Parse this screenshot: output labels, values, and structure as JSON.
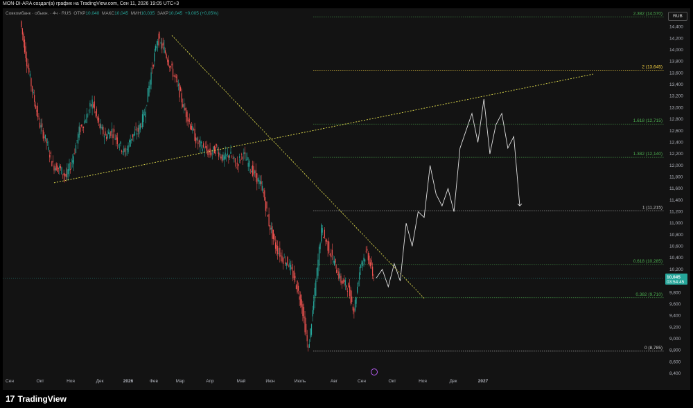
{
  "header": {
    "title": "MON-DI-ARA создал(а) график на TradingView.com, Сен 11, 2026 19:05 UTC+3"
  },
  "legend": {
    "symbol": "Совкомбанк · обыкн. · 4ч · RUS",
    "open_label": "ОТКР",
    "open": "10,040",
    "high_label": "МАКС",
    "high": "10,045",
    "low_label": "МИН",
    "low": "10,035",
    "close_label": "ЗАКР",
    "close": "10,045",
    "change": "+0,005 (+0,05%)"
  },
  "currency": "RUB",
  "price_badge": {
    "price": "10,045",
    "timer": "03:54:45",
    "color": "#26a69a"
  },
  "footer": {
    "brand": "TradingView"
  },
  "chart_data": {
    "type": "candlestick",
    "ylim": [
      8400,
      14600
    ],
    "y_ticks": [
      "8,400",
      "8,600",
      "8,800",
      "9,000",
      "9,200",
      "9,400",
      "9,600",
      "9,800",
      "10,000",
      "10,200",
      "10,400",
      "10,600",
      "10,800",
      "11,000",
      "11,200",
      "11,400",
      "11,600",
      "11,800",
      "12,000",
      "12,200",
      "12,400",
      "12,600",
      "12,800",
      "13,000",
      "13,200",
      "13,400",
      "13,600",
      "13,800",
      "14,000",
      "14,200",
      "14,400"
    ],
    "x_ticks": [
      "Сен",
      "Окт",
      "Ноя",
      "Дек",
      "2026",
      "Фев",
      "Мар",
      "Апр",
      "Май",
      "Июн",
      "Июль",
      "Авг",
      "Сен",
      "Окт",
      "Ноя",
      "Дек",
      "2027"
    ],
    "price_path": [
      [
        0,
        14500
      ],
      [
        2,
        13800
      ],
      [
        4,
        13200
      ],
      [
        6,
        12700
      ],
      [
        8,
        12400
      ],
      [
        10,
        12000
      ],
      [
        12,
        11950
      ],
      [
        14,
        11800
      ],
      [
        16,
        12100
      ],
      [
        18,
        12600
      ],
      [
        20,
        12800
      ],
      [
        22,
        13100
      ],
      [
        24,
        12700
      ],
      [
        26,
        12500
      ],
      [
        28,
        12600
      ],
      [
        30,
        12400
      ],
      [
        32,
        12200
      ],
      [
        34,
        12500
      ],
      [
        36,
        12600
      ],
      [
        38,
        12900
      ],
      [
        40,
        13600
      ],
      [
        42,
        14200
      ],
      [
        44,
        14000
      ],
      [
        46,
        13700
      ],
      [
        48,
        13400
      ],
      [
        50,
        13000
      ],
      [
        52,
        12700
      ],
      [
        54,
        12400
      ],
      [
        56,
        12300
      ],
      [
        58,
        12200
      ],
      [
        60,
        12300
      ],
      [
        62,
        12100
      ],
      [
        64,
        12200
      ],
      [
        66,
        12000
      ],
      [
        68,
        12200
      ],
      [
        70,
        12000
      ],
      [
        72,
        11800
      ],
      [
        74,
        11600
      ],
      [
        76,
        11000
      ],
      [
        78,
        10600
      ],
      [
        80,
        10400
      ],
      [
        82,
        10300
      ],
      [
        84,
        10000
      ],
      [
        86,
        9600
      ],
      [
        88,
        8800
      ],
      [
        90,
        9800
      ],
      [
        92,
        10900
      ],
      [
        94,
        10600
      ],
      [
        96,
        10300
      ],
      [
        98,
        10000
      ],
      [
        100,
        9900
      ],
      [
        102,
        9500
      ],
      [
        104,
        10300
      ],
      [
        106,
        10500
      ],
      [
        108,
        10050
      ]
    ],
    "projection_path": [
      [
        0,
        10050
      ],
      [
        1,
        10200
      ],
      [
        2,
        9900
      ],
      [
        3,
        10300
      ],
      [
        4,
        10000
      ],
      [
        5,
        11000
      ],
      [
        6,
        10600
      ],
      [
        7,
        11200
      ],
      [
        8,
        11100
      ],
      [
        9,
        12000
      ],
      [
        10,
        11500
      ],
      [
        11,
        11300
      ],
      [
        12,
        11600
      ],
      [
        13,
        11200
      ],
      [
        14,
        12300
      ],
      [
        15,
        12600
      ],
      [
        16,
        12900
      ],
      [
        17,
        12400
      ],
      [
        18,
        13150
      ],
      [
        19,
        12200
      ],
      [
        20,
        12700
      ],
      [
        21,
        12900
      ],
      [
        22,
        12300
      ],
      [
        23,
        12500
      ],
      [
        24,
        11300
      ]
    ],
    "fib_levels": [
      {
        "label": "0 (8,785)",
        "value": 8785,
        "color": "#cccccc"
      },
      {
        "label": "0.382 (9,710)",
        "value": 9710,
        "color": "#4caf50"
      },
      {
        "label": "0.618 (10,285)",
        "value": 10285,
        "color": "#4caf50"
      },
      {
        "label": "1 (11,215)",
        "value": 11215,
        "color": "#cccccc"
      },
      {
        "label": "1.382 (12,140)",
        "value": 12140,
        "color": "#4caf50"
      },
      {
        "label": "1.618 (12,715)",
        "value": 12715,
        "color": "#4caf50"
      },
      {
        "label": "2 (13,645)",
        "value": 13645,
        "color": "#f5d142"
      },
      {
        "label": "2.382 (14,570)",
        "value": 14570,
        "color": "#4caf50"
      }
    ],
    "colors": {
      "up": "#26a69a",
      "down": "#ef5350",
      "trend": "#d6d24a",
      "projection": "#e0e0e0",
      "bg": "#131313"
    }
  }
}
